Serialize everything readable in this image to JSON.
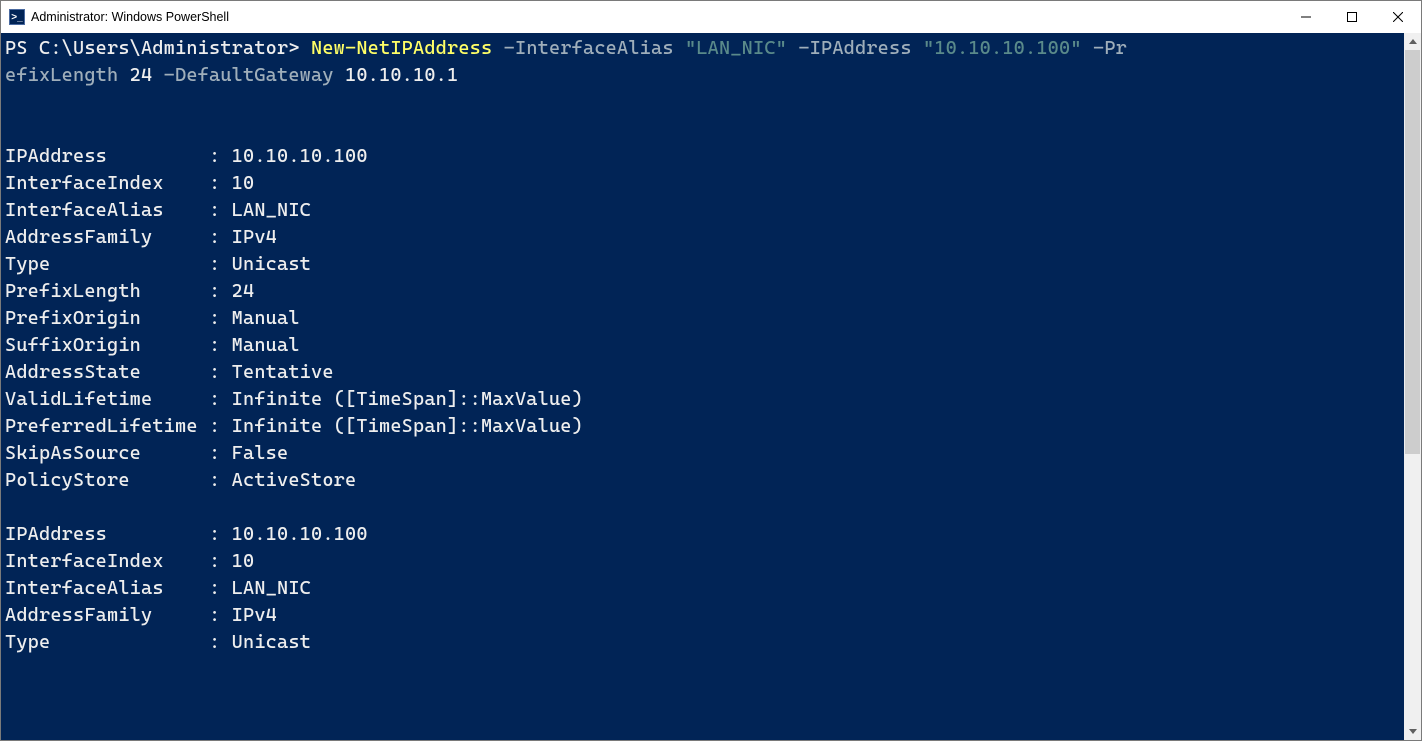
{
  "window": {
    "title": "Administrator: Windows PowerShell"
  },
  "prompt": {
    "path": "PS C:\\Users\\Administrator> ",
    "cmdlet": "New-NetIPAddress",
    "p_InterfaceAlias": " -InterfaceAlias ",
    "v_InterfaceAlias": "\"LAN_NIC\"",
    "p_IPAddress": " -IPAddress ",
    "v_IPAddress": "\"10.10.10.100\"",
    "p_PrefixLength_a": " -Pr",
    "p_PrefixLength_b": "efixLength ",
    "v_PrefixLength": "24",
    "p_DefaultGateway": " -DefaultGateway ",
    "v_DefaultGateway": "10.10.10.1"
  },
  "output": {
    "blocks": [
      {
        "rows": [
          {
            "k": "IPAddress",
            "v": "10.10.10.100"
          },
          {
            "k": "InterfaceIndex",
            "v": "10"
          },
          {
            "k": "InterfaceAlias",
            "v": "LAN_NIC"
          },
          {
            "k": "AddressFamily",
            "v": "IPv4"
          },
          {
            "k": "Type",
            "v": "Unicast"
          },
          {
            "k": "PrefixLength",
            "v": "24"
          },
          {
            "k": "PrefixOrigin",
            "v": "Manual"
          },
          {
            "k": "SuffixOrigin",
            "v": "Manual"
          },
          {
            "k": "AddressState",
            "v": "Tentative"
          },
          {
            "k": "ValidLifetime",
            "v": "Infinite ([TimeSpan]::MaxValue)"
          },
          {
            "k": "PreferredLifetime",
            "v": "Infinite ([TimeSpan]::MaxValue)"
          },
          {
            "k": "SkipAsSource",
            "v": "False"
          },
          {
            "k": "PolicyStore",
            "v": "ActiveStore"
          }
        ]
      },
      {
        "rows": [
          {
            "k": "IPAddress",
            "v": "10.10.10.100"
          },
          {
            "k": "InterfaceIndex",
            "v": "10"
          },
          {
            "k": "InterfaceAlias",
            "v": "LAN_NIC"
          },
          {
            "k": "AddressFamily",
            "v": "IPv4"
          },
          {
            "k": "Type",
            "v": "Unicast"
          }
        ]
      }
    ],
    "key_col_width": 18
  }
}
